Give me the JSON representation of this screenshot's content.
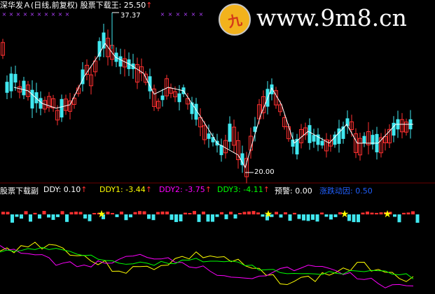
{
  "main_panel": {
    "title": "深华发Ａ(日线,前复权)",
    "indicator_name": "股票下载王",
    "indicator_value": ": 25.50",
    "arrow": "↑",
    "peak_label": "37.37",
    "trough_label": "20.00"
  },
  "sub_panel": {
    "name": "股票下载副",
    "ddy": {
      "label": "DDY: 0.10",
      "color": "#ffffff"
    },
    "ddy1": {
      "label": "DDY1: -3.44",
      "color": "#ffff00"
    },
    "ddy2": {
      "label": "DDY2: -3.75",
      "color": "#ff00ff"
    },
    "ddy3": {
      "label": "DDY3: -4.11",
      "color": "#00ff00"
    },
    "warn": {
      "label": "预警: 0.00",
      "color": "#ffffff"
    },
    "fund": {
      "label": "涨跌动因: 0.50",
      "color": "#2060ff"
    },
    "arrow": "↑"
  },
  "watermark": {
    "logo_text": "九",
    "site_text": "www.9m8.cn"
  },
  "colors": {
    "up": "#ff3030",
    "down": "#40e8f0",
    "line_white": "#ffffff",
    "line_yellow": "#ffff00",
    "line_magenta": "#ff00ff",
    "line_green": "#00ff00",
    "star": "#ffff00",
    "cross": "#b040ff"
  }
}
